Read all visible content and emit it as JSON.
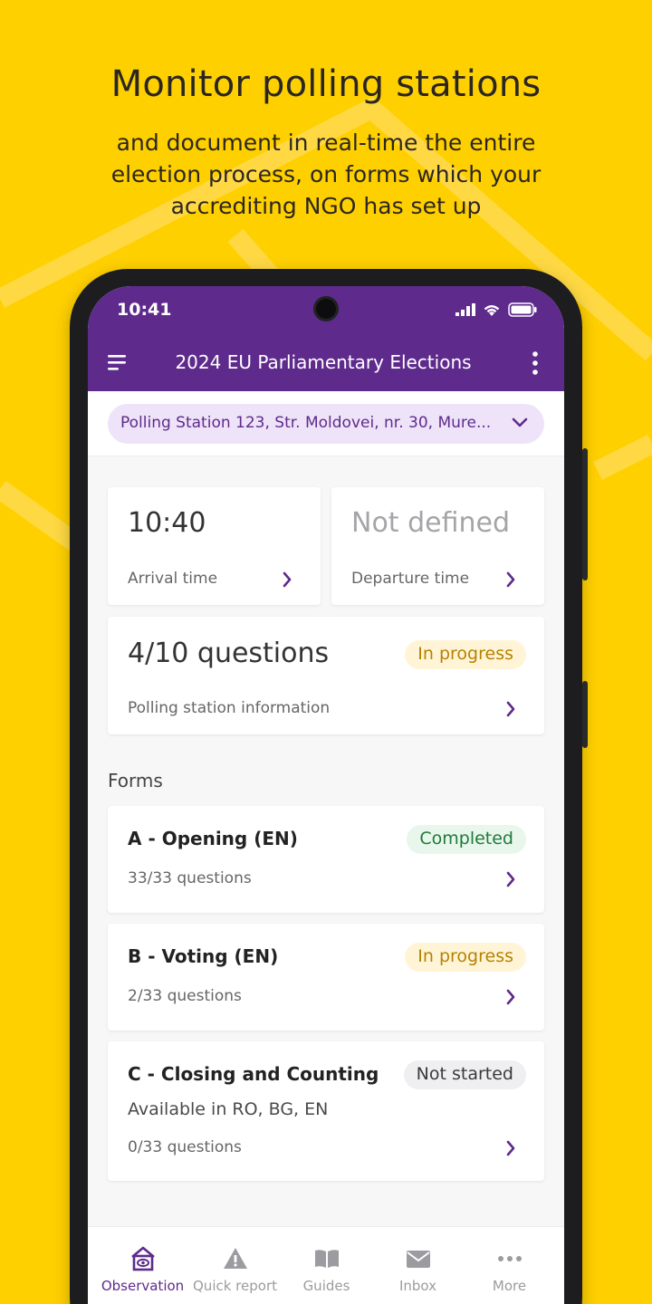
{
  "header": {
    "title": "Monitor polling stations",
    "subtitle": "and document in real-time the entire election process, on forms which your accrediting NGO has set up"
  },
  "status_bar": {
    "time": "10:41"
  },
  "app_bar": {
    "title": "2024 EU Parliamentary Elections"
  },
  "polling_station": {
    "label": "Polling Station 123, Str. Moldovei, nr. 30, Mure..."
  },
  "arrival": {
    "value": "10:40",
    "label": "Arrival time"
  },
  "departure": {
    "value": "Not defined",
    "label": "Departure time"
  },
  "station_info": {
    "progress": "4/10 questions",
    "status": "In progress",
    "label": "Polling station information"
  },
  "forms_section": {
    "title": "Forms"
  },
  "forms": [
    {
      "title": "A - Opening (EN)",
      "status": "Completed",
      "questions": "33/33 questions"
    },
    {
      "title": "B - Voting (EN)",
      "status": "In progress",
      "questions": "2/33 questions"
    },
    {
      "title": "C - Closing and Counting",
      "status": "Not started",
      "availability": "Available in RO, BG, EN",
      "questions": "0/33 questions"
    }
  ],
  "bottom_nav": [
    {
      "label": "Observation",
      "icon": "observation-icon",
      "active": true
    },
    {
      "label": "Quick report",
      "icon": "warning-icon",
      "active": false
    },
    {
      "label": "Guides",
      "icon": "book-icon",
      "active": false
    },
    {
      "label": "Inbox",
      "icon": "mail-icon",
      "active": false
    },
    {
      "label": "More",
      "icon": "dots-icon",
      "active": false
    }
  ],
  "colors": {
    "background": "#FFD000",
    "brand_purple": "#5E2B8D",
    "in_progress": "#B78100",
    "completed": "#1F7A3A"
  }
}
